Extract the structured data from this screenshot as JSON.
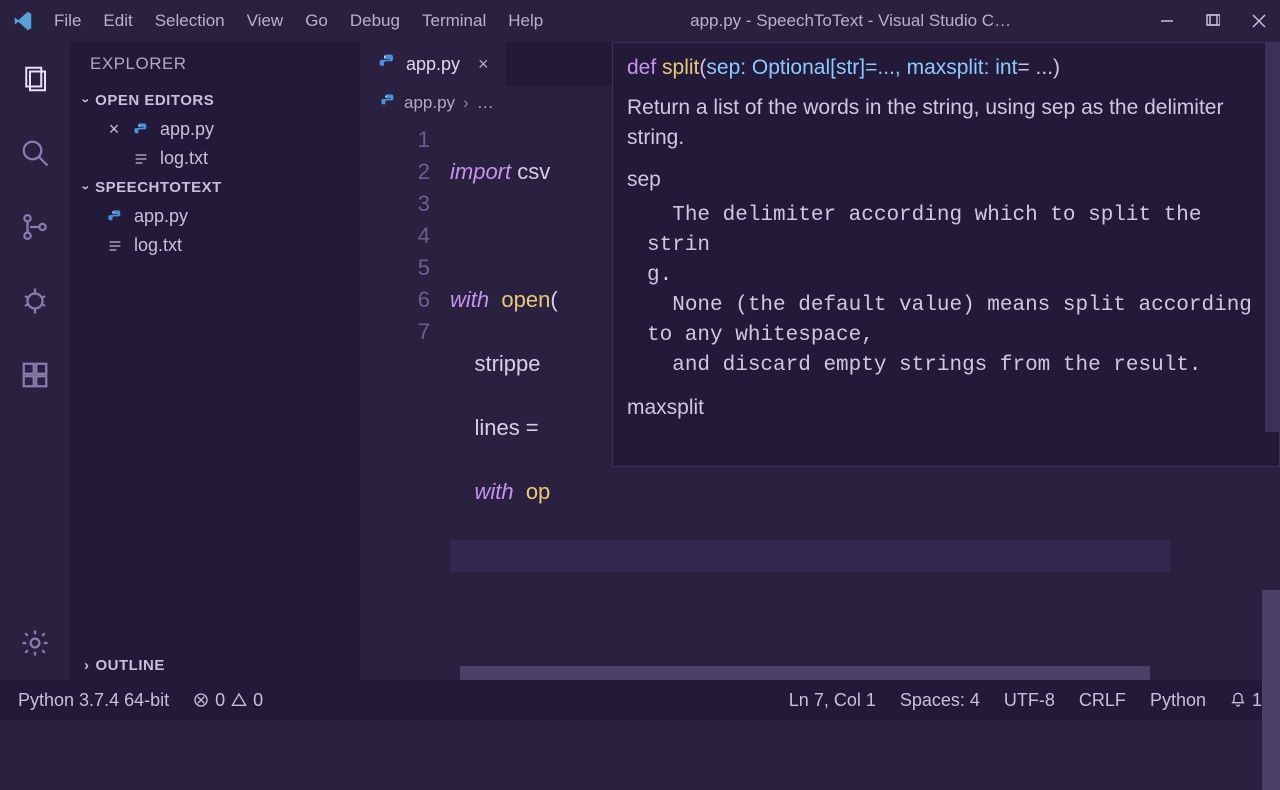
{
  "menu": [
    "File",
    "Edit",
    "Selection",
    "View",
    "Go",
    "Debug",
    "Terminal",
    "Help"
  ],
  "window_title": "app.py - SpeechToText - Visual Studio C…",
  "sidebar": {
    "title": "EXPLORER",
    "open_editors_label": "OPEN EDITORS",
    "open_editors": [
      {
        "name": "app.py",
        "icon": "python"
      },
      {
        "name": "log.txt",
        "icon": "text"
      }
    ],
    "folder_label": "SPEECHTOTEXT",
    "folder_files": [
      {
        "name": "app.py",
        "icon": "python"
      },
      {
        "name": "log.txt",
        "icon": "text"
      }
    ],
    "outline_label": "OUTLINE"
  },
  "tab": {
    "name": "app.py"
  },
  "breadcrumb": {
    "file": "app.py",
    "rest": "…"
  },
  "code": {
    "lines": [
      "1",
      "2",
      "3",
      "4",
      "5",
      "6",
      "7"
    ],
    "l1_a": "import",
    "l1_b": " csv",
    "l3_a": "with",
    "l3_b": " open",
    "l3_c": "(",
    "l4": "strippe",
    "l5": "lines =",
    "l6_a": "with",
    "l6_b": " op"
  },
  "hover": {
    "sig_def": "def ",
    "sig_name": "split",
    "sig_open": "(",
    "sig_p1": "sep: Optional[str]=..., ",
    "sig_p2": "maxsplit: int",
    "sig_tail": "= ...)",
    "doc": "Return a list of the words in the string, using sep as the delimiter string.",
    "param1": "sep",
    "param1_desc": "  The delimiter according which to split the strin\ng.\n  None (the default value) means split according to any whitespace,\n  and discard empty strings from the result.",
    "param2": "maxsplit"
  },
  "status": {
    "python": "Python 3.7.4 64-bit",
    "errors": "0",
    "warnings": "0",
    "cursor": "Ln 7, Col 1",
    "spaces": "Spaces: 4",
    "encoding": "UTF-8",
    "eol": "CRLF",
    "lang": "Python",
    "bell": "1"
  }
}
